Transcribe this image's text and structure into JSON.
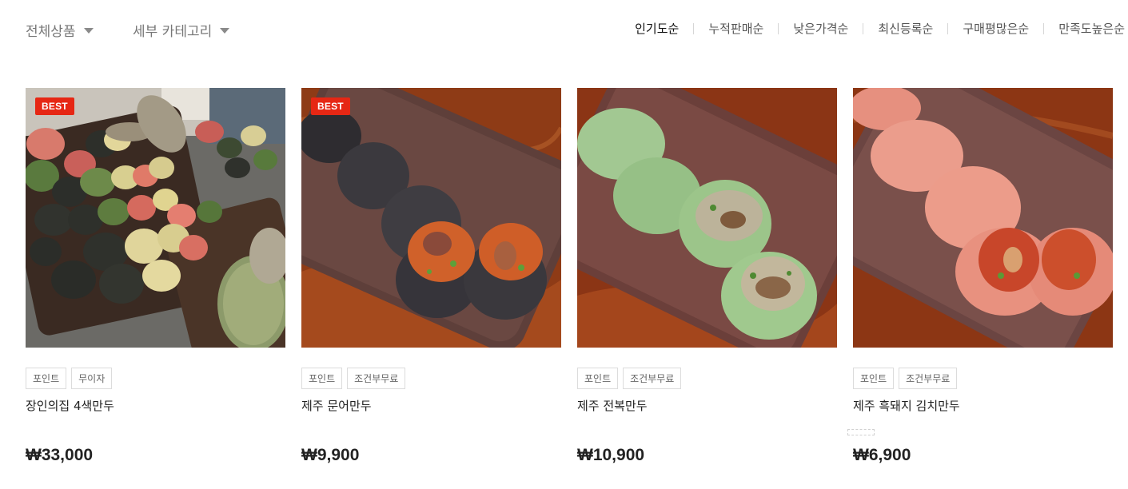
{
  "filters": {
    "all_products": "전체상품",
    "sub_category": "세부 카테고리"
  },
  "sort_options": [
    {
      "label": "인기도순",
      "active": true
    },
    {
      "label": "누적판매순",
      "active": false
    },
    {
      "label": "낮은가격순",
      "active": false
    },
    {
      "label": "최신등록순",
      "active": false
    },
    {
      "label": "구매평많은순",
      "active": false
    },
    {
      "label": "만족도높은순",
      "active": false
    }
  ],
  "products": [
    {
      "name": "장인의집 4색만두",
      "price": "₩33,000",
      "badge": "BEST",
      "tags": [
        "포인트",
        "무이자"
      ]
    },
    {
      "name": "제주 문어만두",
      "price": "₩9,900",
      "badge": "BEST",
      "tags": [
        "포인트",
        "조건부무료"
      ]
    },
    {
      "name": "제주 전복만두",
      "price": "₩10,900",
      "badge": "",
      "tags": [
        "포인트",
        "조건부무료"
      ]
    },
    {
      "name": "제주 흑돼지 김치만두",
      "price": "₩6,900",
      "badge": "",
      "tags": [
        "포인트",
        "조건부무료"
      ]
    }
  ],
  "colors": {
    "badge": "#e62714",
    "dumpling_squid_ink": "#3e3b40",
    "dumpling_green": "#9bc48a",
    "dumpling_pink": "#e89a8a",
    "wood": "#8a3a1c"
  }
}
